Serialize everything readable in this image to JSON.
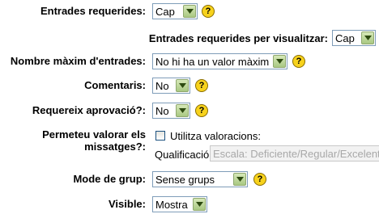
{
  "form": {
    "required_entries": {
      "label": "Entrades requerides:",
      "value": "Cap"
    },
    "required_entries_view": {
      "label": "Entrades requerides per visualitzar:",
      "value": "Cap"
    },
    "max_entries": {
      "label": "Nombre màxim d'entrades:",
      "value": "No hi ha un valor màxim"
    },
    "comments": {
      "label": "Comentaris:",
      "value": "No"
    },
    "approval": {
      "label": "Requereix aprovació?:",
      "value": "No"
    },
    "ratings": {
      "label_line1": "Permeteu valorar els",
      "label_line2": "missatges?:",
      "checkbox_label": "Utilitza valoracions:",
      "grade_label": "Qualificació:",
      "grade_value": "Escala: Deficiente/Regular/Excelente"
    },
    "group_mode": {
      "label": "Mode de grup:",
      "value": "Sense grups"
    },
    "visible": {
      "label": "Visible:",
      "value": "Mostra"
    }
  },
  "icons": {
    "help": "help-icon",
    "dropdown": "chevron-down-icon",
    "checkbox": "checkbox-unchecked"
  }
}
